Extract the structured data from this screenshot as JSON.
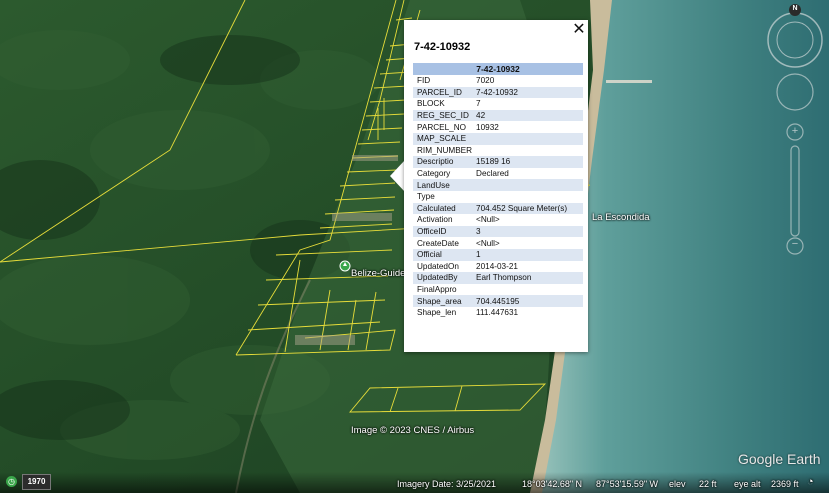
{
  "popup": {
    "title": "7-42-10932",
    "close_glyph": "✕",
    "table_header": "7-42-10932",
    "rows": [
      {
        "key": "FID",
        "value": "7020"
      },
      {
        "key": "PARCEL_ID",
        "value": "7-42-10932"
      },
      {
        "key": "BLOCK",
        "value": "7"
      },
      {
        "key": "REG_SEC_ID",
        "value": "42"
      },
      {
        "key": "PARCEL_NO",
        "value": "10932"
      },
      {
        "key": "MAP_SCALE",
        "value": ""
      },
      {
        "key": "RIM_NUMBER",
        "value": ""
      },
      {
        "key": "Descriptio",
        "value": "15189 16"
      },
      {
        "key": "Category",
        "value": "Declared"
      },
      {
        "key": "LandUse",
        "value": ""
      },
      {
        "key": "Type",
        "value": ""
      },
      {
        "key": "Calculated",
        "value": "704.452 Square Meter(s)"
      },
      {
        "key": "Activation",
        "value": "<Null>"
      },
      {
        "key": "OfficeID",
        "value": "3"
      },
      {
        "key": "CreateDate",
        "value": "<Null>"
      },
      {
        "key": "Official",
        "value": "1"
      },
      {
        "key": "UpdatedOn",
        "value": "2014-03-21"
      },
      {
        "key": "UpdatedBy",
        "value": "Earl Thompson"
      },
      {
        "key": "FinalAppro",
        "value": ""
      },
      {
        "key": "Shape_area",
        "value": "704.445195"
      },
      {
        "key": "Shape_len",
        "value": "111.447631"
      }
    ]
  },
  "map_labels": {
    "place_1": "La Escondida",
    "place_2": "Belize-Guide",
    "attribution": "Image © 2023 CNES / Airbus",
    "logo": "Google Earth"
  },
  "status": {
    "history_year": "1970",
    "imagery_date": "Imagery Date: 3/25/2021",
    "lat": "18°03'42.68\" N",
    "lon": "87°53'15.59\" W",
    "elev_label": "elev",
    "elev_value": "22 ft",
    "eye_alt_label": "eye alt",
    "eye_alt_value": "2369 ft"
  },
  "nav": {
    "compass_letter": "N"
  },
  "colors": {
    "parcel_lines": "#e6dc3a",
    "sea": "#4f8f8c",
    "forest": "#1f4a25",
    "beach": "#c8b99a",
    "table_header_bg": "#a8c1e4",
    "table_alt_row_bg": "#dde6f2"
  }
}
